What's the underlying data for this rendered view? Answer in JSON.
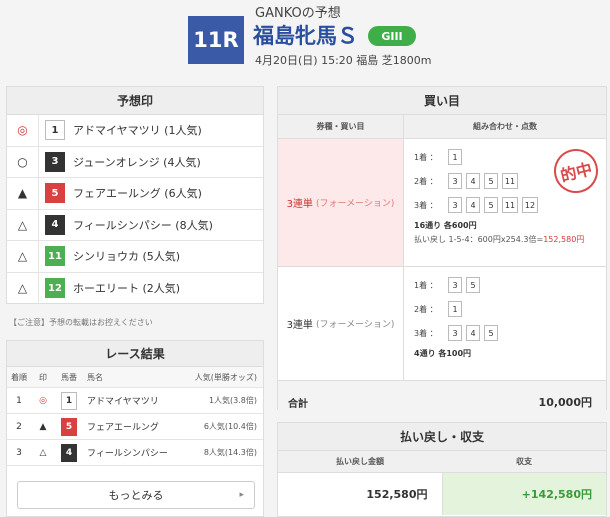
{
  "header": {
    "author": "GANKOの予想",
    "race_number": "11R",
    "race_name": "福島牝馬Ｓ",
    "grade": "GIII",
    "info": "4月20日(日) 15:20 福島 芝1800m"
  },
  "marks": {
    "title": "予想印",
    "notice": "【ご注意】予想の転載はお控えください",
    "rows": [
      {
        "mark": "◎",
        "num": "1",
        "name": "アドマイヤマツリ (1人気)",
        "bg": "#ffffff",
        "fg": "#333333",
        "mark_color": "#d23a3a"
      },
      {
        "mark": "○",
        "num": "3",
        "name": "ジューンオレンジ (4人気)",
        "bg": "#333333",
        "fg": "#ffffff",
        "mark_color": "#333333"
      },
      {
        "mark": "▲",
        "num": "5",
        "name": "フェアエールング (6人気)",
        "bg": "#d94040",
        "fg": "#ffffff",
        "mark_color": "#333333"
      },
      {
        "mark": "△",
        "num": "4",
        "name": "フィールシンパシー (8人気)",
        "bg": "#333333",
        "fg": "#ffffff",
        "mark_color": "#333333"
      },
      {
        "mark": "△",
        "num": "11",
        "name": "シンリョウカ (5人気)",
        "bg": "#4caf50",
        "fg": "#ffffff",
        "mark_color": "#333333"
      },
      {
        "mark": "△",
        "num": "12",
        "name": "ホーエリート (2人気)",
        "bg": "#4caf50",
        "fg": "#ffffff",
        "mark_color": "#333333"
      }
    ]
  },
  "results": {
    "title": "レース結果",
    "headers": {
      "rank": "着順",
      "mark": "印",
      "num": "馬番",
      "name": "馬名",
      "pop": "人気(単勝オッズ)"
    },
    "rows": [
      {
        "rank": "1",
        "mark": "◎",
        "num": "1",
        "name": "アドマイヤマツリ",
        "pop": "1人気(3.8倍)",
        "bg": "#ffffff",
        "fg": "#333333",
        "mark_color": "#d23a3a"
      },
      {
        "rank": "2",
        "mark": "▲",
        "num": "5",
        "name": "フェアエールング",
        "pop": "6人気(10.4倍)",
        "bg": "#d94040",
        "fg": "#ffffff",
        "mark_color": "#333333"
      },
      {
        "rank": "3",
        "mark": "△",
        "num": "4",
        "name": "フィールシンパシー",
        "pop": "8人気(14.3倍)",
        "bg": "#333333",
        "fg": "#ffffff",
        "mark_color": "#333333"
      }
    ],
    "more_label": "もっとみる",
    "more_arrow": "▸"
  },
  "bets": {
    "title": "買い目",
    "col_type": "券種・買い目",
    "col_combo": "組み合わせ・点数",
    "hit_stamp": "的中",
    "rows": [
      {
        "type": "3連単",
        "method": "(フォーメーション)",
        "hit": true,
        "lines": [
          {
            "label": "1着 ：",
            "nums": [
              "1"
            ]
          },
          {
            "label": "2着 ：",
            "nums": [
              "3",
              "4",
              "5",
              "11"
            ]
          },
          {
            "label": "3着 ：",
            "nums": [
              "3",
              "4",
              "5",
              "11",
              "12"
            ]
          }
        ],
        "summary": "16通り 各600円",
        "payout_prefix": "払い戻し 1-5-4：600円x254.3倍=",
        "payout_value": "152,580円"
      },
      {
        "type": "3連単",
        "method": "(フォーメーション)",
        "hit": false,
        "lines": [
          {
            "label": "1着 ：",
            "nums": [
              "3",
              "5"
            ]
          },
          {
            "label": "2着 ：",
            "nums": [
              "1"
            ]
          },
          {
            "label": "3着 ：",
            "nums": [
              "3",
              "4",
              "5"
            ]
          }
        ],
        "summary": "4通り 各100円",
        "payout_prefix": "",
        "payout_value": ""
      }
    ],
    "total_label": "合計",
    "total_value": "10,000円"
  },
  "payout": {
    "title": "払い戻し・収支",
    "col_refund": "払い戻し金額",
    "col_balance": "収支",
    "refund": "152,580円",
    "balance": "+142,580円"
  }
}
